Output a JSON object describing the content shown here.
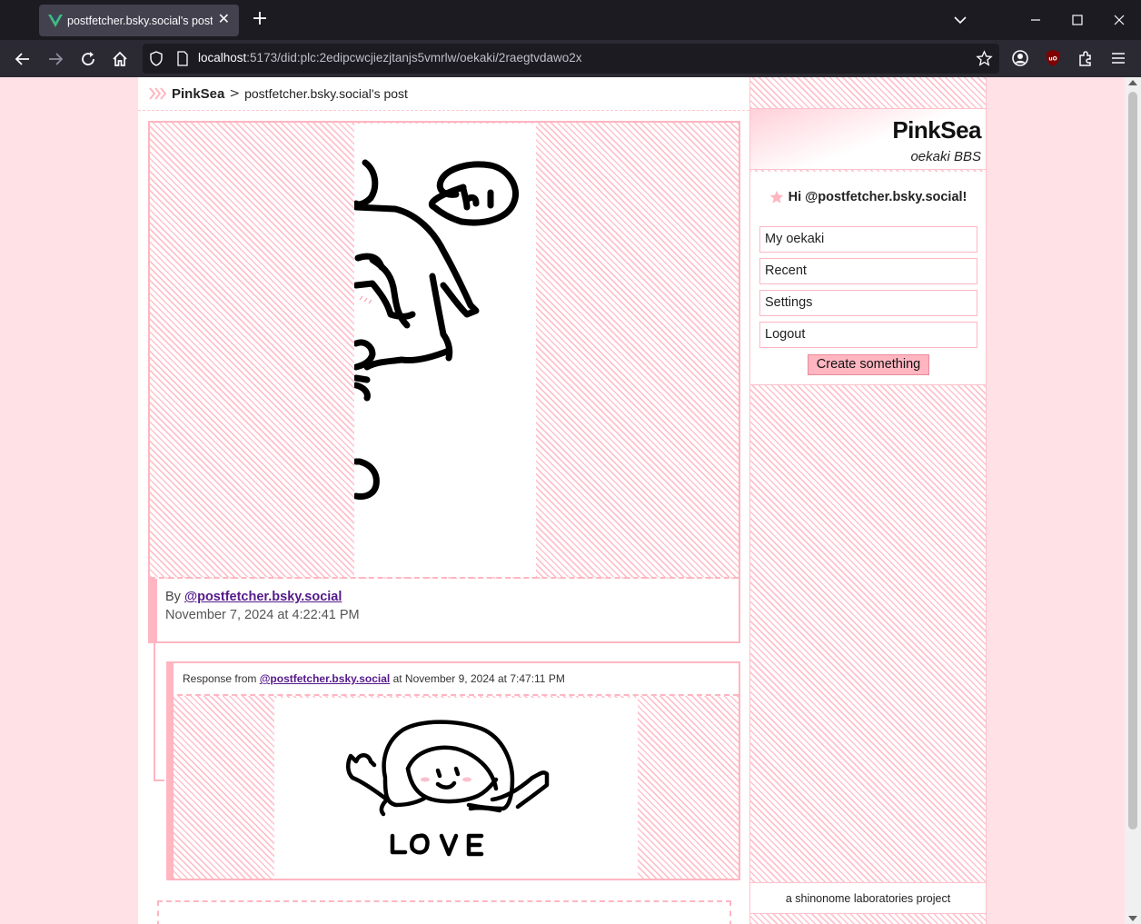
{
  "browser": {
    "tab_title": "postfetcher.bsky.social's post / ",
    "url_host": "localhost",
    "url_rest": ":5173/did:plc:2edipcwcjiezjtanjs5vmrlw/oekaki/2raegtvdawo2x",
    "icons": [
      "vue-favicon",
      "close-tab-icon",
      "new-tab-icon",
      "tab-list-icon",
      "minimize-icon",
      "maximize-icon",
      "close-window-icon",
      "back-icon",
      "forward-icon",
      "reload-icon",
      "home-icon",
      "shield-icon",
      "page-icon",
      "bookmark-star-icon",
      "account-icon",
      "ublock-icon",
      "extensions-icon",
      "menu-icon"
    ]
  },
  "breadcrumb": {
    "home": "PinkSea",
    "separator": ">",
    "current": "postfetcher.bsky.social's post"
  },
  "post": {
    "by_label": "By",
    "author": "@postfetcher.bsky.social",
    "date": "November 7, 2024 at 4:22:41 PM"
  },
  "response": {
    "prefix": "Response from",
    "author": "@postfetcher.bsky.social",
    "date_text": "at November 9, 2024 at 7:47:11 PM"
  },
  "sidebar": {
    "title": "PinkSea",
    "subtitle": "oekaki BBS",
    "greeting": "Hi @postfetcher.bsky.social!",
    "links": [
      "My oekaki",
      "Recent",
      "Settings",
      "Logout"
    ],
    "create_label": "Create something",
    "footer": "a shinonome laboratories project"
  },
  "colors": {
    "accent_pink": "#ffb6c1",
    "page_bg": "#ffe1e6",
    "link": "#551a8b"
  }
}
